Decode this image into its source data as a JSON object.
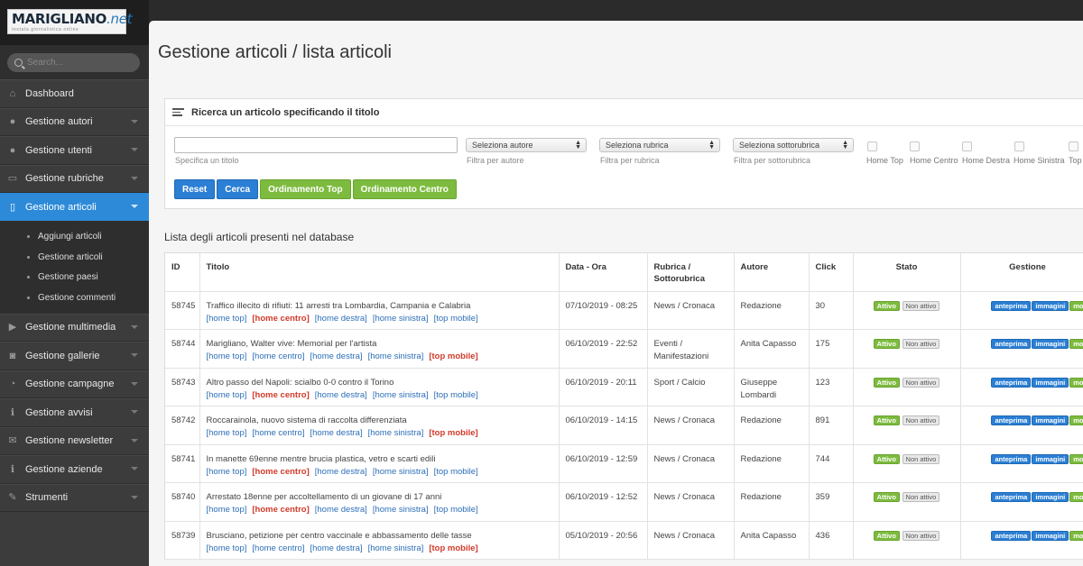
{
  "sidebar": {
    "logo": {
      "brand": "MARIGLIANO",
      "brand_suffix": ".net",
      "tagline": "testata giornalistica online"
    },
    "search_placeholder": "Search...",
    "nav": [
      {
        "label": "Dashboard",
        "icon": "home-icon",
        "active": false,
        "chevron": false
      },
      {
        "label": "Gestione autori",
        "icon": "user-icon",
        "active": false,
        "chevron": true
      },
      {
        "label": "Gestione utenti",
        "icon": "user-icon",
        "active": false,
        "chevron": true
      },
      {
        "label": "Gestione rubriche",
        "icon": "folder-icon",
        "active": false,
        "chevron": true
      },
      {
        "label": "Gestione articoli",
        "icon": "file-icon",
        "active": true,
        "chevron": true
      }
    ],
    "submenu": [
      "Aggiungi articoli",
      "Gestione articoli",
      "Gestione paesi",
      "Gestione commenti"
    ],
    "nav2": [
      {
        "label": "Gestione multimedia",
        "icon": "play-icon"
      },
      {
        "label": "Gestione gallerie",
        "icon": "camera-icon"
      },
      {
        "label": "Gestione campagne",
        "icon": "pie-chart-icon"
      },
      {
        "label": "Gestione avvisi",
        "icon": "info-icon"
      },
      {
        "label": "Gestione newsletter",
        "icon": "envelope-icon"
      },
      {
        "label": "Gestione aziende",
        "icon": "info-icon"
      },
      {
        "label": "Strumenti",
        "icon": "wrench-icon"
      }
    ]
  },
  "page": {
    "title": "Gestione articoli / lista articoli"
  },
  "search_panel": {
    "heading": "Ricerca un articolo specificando il titolo",
    "title_hint": "Specifica un titolo",
    "selects": [
      {
        "value": "Seleziona autore",
        "hint": "Filtra per autore"
      },
      {
        "value": "Seleziona rubrica",
        "hint": "Filtra per rubrica"
      },
      {
        "value": "Seleziona sottorubrica",
        "hint": "Filtra per sottorubrica"
      }
    ],
    "checkboxes": [
      "Home Top",
      "Home Centro",
      "Home Destra",
      "Home Sinistra",
      "Top"
    ],
    "buttons": {
      "reset": "Reset",
      "search": "Cerca",
      "order_top": "Ordinamento Top",
      "order_center": "Ordinamento Centro"
    }
  },
  "list": {
    "title": "Lista degli articoli presenti nel database",
    "columns": [
      "ID",
      "Titolo",
      "Data - Ora",
      "Rubrica / Sottorubrica",
      "Autore",
      "Click",
      "Stato",
      "Gestione"
    ],
    "link_labels": [
      "[home top]",
      "[home centro]",
      "[home destra]",
      "[home sinistra]",
      "[top mobile]"
    ],
    "status_labels": {
      "on": "Attivo",
      "off": "Non attivo"
    },
    "action_labels": [
      "anteprima",
      "immagini",
      "mo"
    ],
    "rows": [
      {
        "id": "58745",
        "title": "Traffico illecito di rifiuti: 11 arresti tra Lombardia, Campania e Calabria",
        "date": "07/10/2019 - 08:25",
        "rubrica": "News / Cronaca",
        "autore": "Redazione",
        "click": "30",
        "active_link": 1
      },
      {
        "id": "58744",
        "title": "Marigliano, Walter vive: Memorial per l'artista",
        "date": "06/10/2019 - 22:52",
        "rubrica": "Eventi / Manifestazioni",
        "autore": "Anita Capasso",
        "click": "175",
        "active_link": 4
      },
      {
        "id": "58743",
        "title": "Altro passo del Napoli: scialbo 0-0 contro il Torino",
        "date": "06/10/2019 - 20:11",
        "rubrica": "Sport / Calcio",
        "autore": "Giuseppe Lombardi",
        "click": "123",
        "active_link": 1
      },
      {
        "id": "58742",
        "title": "Roccarainola, nuovo sistema di raccolta differenziata",
        "date": "06/10/2019 - 14:15",
        "rubrica": "News / Cronaca",
        "autore": "Redazione",
        "click": "891",
        "active_link": 4
      },
      {
        "id": "58741",
        "title": "In manette 69enne mentre brucia plastica, vetro e scarti edili",
        "date": "06/10/2019 - 12:59",
        "rubrica": "News / Cronaca",
        "autore": "Redazione",
        "click": "744",
        "active_link": 1
      },
      {
        "id": "58740",
        "title": "Arrestato 18enne per accoltellamento di un giovane di 17 anni",
        "date": "06/10/2019 - 12:52",
        "rubrica": "News / Cronaca",
        "autore": "Redazione",
        "click": "359",
        "active_link": 1
      },
      {
        "id": "58739",
        "title": "Brusciano, petizione per centro vaccinale e abbassamento delle tasse",
        "date": "05/10/2019 - 20:56",
        "rubrica": "News / Cronaca",
        "autore": "Anita Capasso",
        "click": "436",
        "active_link": 4
      }
    ]
  }
}
